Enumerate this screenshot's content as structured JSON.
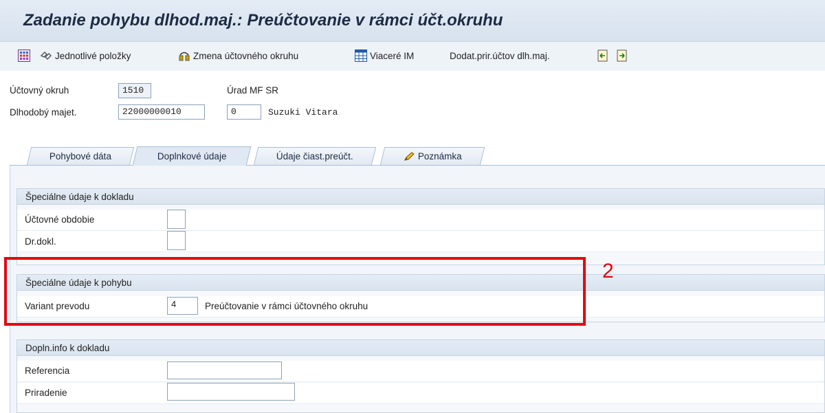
{
  "window": {
    "title": "Zadanie pohybu dlhod.maj.: Preúčtovanie v rámci účt.okruhu"
  },
  "toolbar": {
    "items": [
      {
        "icon": "multi-grid-icon",
        "label": ""
      },
      {
        "icon": "items-icon",
        "label": "Jednotlivé položky"
      },
      {
        "icon": "switch-icon",
        "label": "Zmena účtovného okruhu"
      },
      {
        "icon": "table-icon",
        "label": "Viaceré IM"
      },
      {
        "icon": "",
        "label": "Dodat.prir.účtov dlh.maj."
      },
      {
        "icon": "import-icon",
        "label": ""
      },
      {
        "icon": "export-icon",
        "label": ""
      }
    ]
  },
  "header": {
    "company_code_label": "Účtovný okruh",
    "company_code_value": "1510",
    "company_code_text": "Úrad MF SR",
    "asset_label": "Dlhodobý majet.",
    "asset_value": "22000000010",
    "subnumber_value": "0",
    "asset_text": "Suzuki Vitara"
  },
  "tabs": [
    {
      "label": "Pohybové dáta",
      "active": false
    },
    {
      "label": "Doplnkové údaje",
      "active": true
    },
    {
      "label": "Údaje čiast.preúčt.",
      "active": false
    },
    {
      "label": "Poznámka",
      "active": false,
      "icon": "pencil-icon"
    }
  ],
  "groups": {
    "doc_special": {
      "title": "Špeciálne údaje k dokladu",
      "fields": [
        {
          "label": "Účtovné obdobie",
          "value": ""
        },
        {
          "label": "Dr.dokl.",
          "value": ""
        }
      ]
    },
    "move_special": {
      "title": "Špeciálne údaje k pohybu",
      "fields": [
        {
          "label": "Variant prevodu",
          "value": "4",
          "text": "Preúčtovanie v rámci účtovného okruhu"
        }
      ]
    },
    "doc_info": {
      "title": "Dopln.info k dokladu",
      "fields": [
        {
          "label": "Referencia",
          "value": ""
        },
        {
          "label": "Priradenie",
          "value": ""
        }
      ]
    }
  },
  "annotation": {
    "label": "2",
    "color": "#e30613"
  },
  "colors": {
    "header_bg": "#dae4ef",
    "accent": "#1d2b44",
    "highlight": "#e30613"
  }
}
